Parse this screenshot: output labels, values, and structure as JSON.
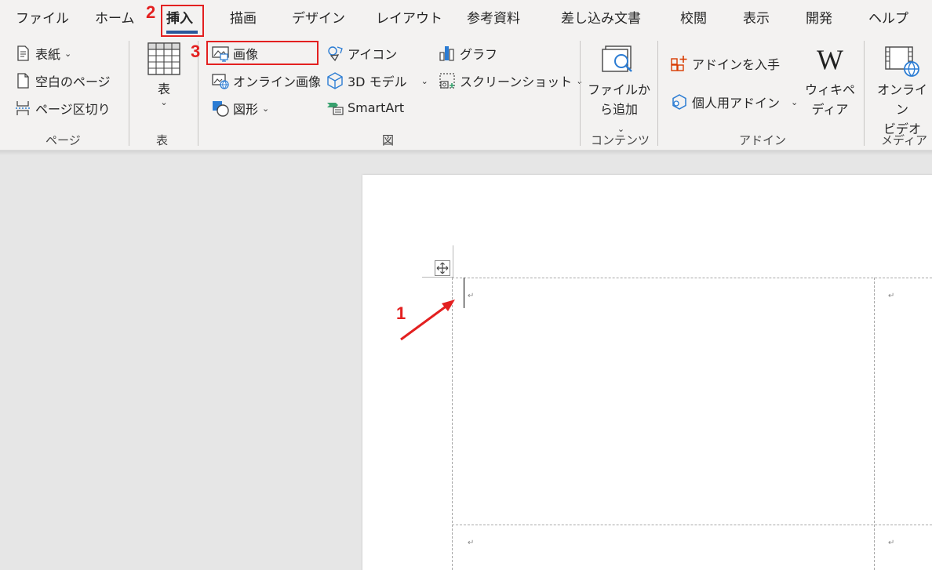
{
  "tabs": [
    {
      "label": "ファイル"
    },
    {
      "label": "ホーム"
    },
    {
      "label": "挿入"
    },
    {
      "label": "描画"
    },
    {
      "label": "デザイン"
    },
    {
      "label": "レイアウト"
    },
    {
      "label": "参考資料"
    },
    {
      "label": "差し込み文書"
    },
    {
      "label": "校閲"
    },
    {
      "label": "表示"
    },
    {
      "label": "開発"
    },
    {
      "label": "ヘルプ"
    }
  ],
  "groups": {
    "page": {
      "label": "ページ",
      "items": [
        {
          "label": "表紙",
          "icon": "cover-page-icon"
        },
        {
          "label": "空白のページ",
          "icon": "blank-page-icon"
        },
        {
          "label": "ページ区切り",
          "icon": "page-break-icon"
        }
      ]
    },
    "table": {
      "label": "表",
      "button_label": "表",
      "icon": "table-grid-icon"
    },
    "illustrations": {
      "label": "図",
      "items": [
        {
          "label": "画像",
          "icon": "picture-icon"
        },
        {
          "label": "オンライン画像",
          "icon": "online-picture-icon"
        },
        {
          "label": "図形",
          "icon": "shapes-icon"
        },
        {
          "label": "アイコン",
          "icon": "icons-icon"
        },
        {
          "label": "3D モデル",
          "icon": "3d-model-icon"
        },
        {
          "label": "SmartArt",
          "icon": "smartart-icon"
        },
        {
          "label": "グラフ",
          "icon": "chart-icon"
        },
        {
          "label": "スクリーンショット",
          "icon": "screenshot-icon"
        }
      ]
    },
    "content": {
      "label": "コンテンツ",
      "button_line1": "ファイルか",
      "button_line2": "ら追加",
      "icon": "file-search-icon"
    },
    "addins": {
      "label": "アドイン",
      "get": "アドインを入手",
      "my": "個人用アドイン",
      "wiki_line1": "ウィキペ",
      "wiki_line2": "ディア",
      "wiki_icon": "W"
    },
    "media": {
      "label": "メディア",
      "line1": "オンライン",
      "line2": "ビデオ",
      "icon": "online-video-icon"
    }
  },
  "annotations": {
    "step1": "1",
    "step2": "2",
    "step3": "3"
  },
  "colors": {
    "accent": "#2b579a",
    "annotation": "#e32020",
    "ribbon": "#f3f2f1",
    "workspace": "#e6e6e6"
  }
}
